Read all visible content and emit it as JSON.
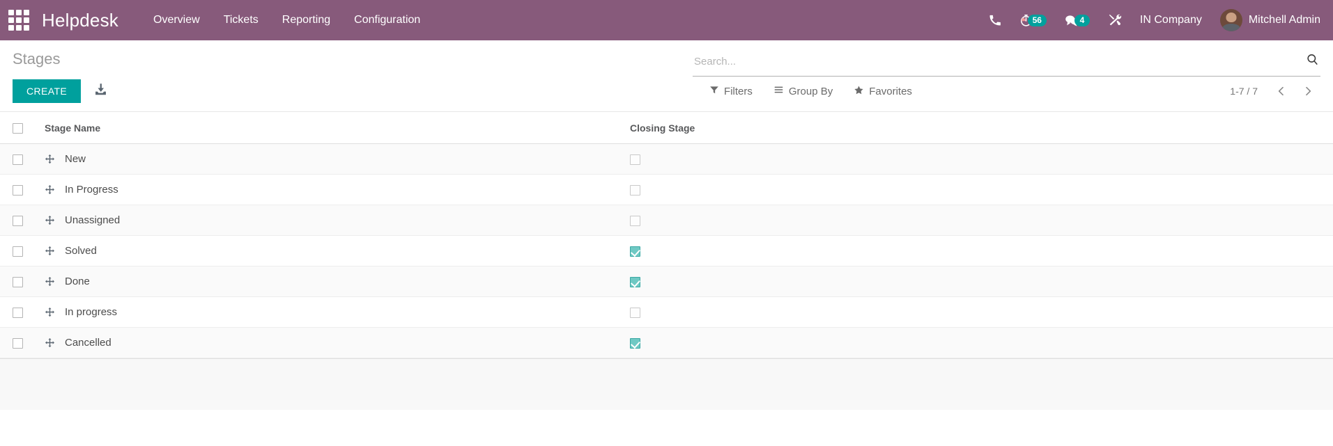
{
  "navbar": {
    "apps_icon": "apps-grid-icon",
    "brand": "Helpdesk",
    "menu_items": [
      {
        "label": "Overview"
      },
      {
        "label": "Tickets"
      },
      {
        "label": "Reporting"
      },
      {
        "label": "Configuration"
      }
    ],
    "icons": {
      "phone": "phone-icon",
      "timer": "timer-icon",
      "messages": "messages-icon",
      "tools": "tools-icon"
    },
    "timer_badge": "56",
    "messages_badge": "4",
    "company": "IN Company",
    "user": "Mitchell Admin",
    "background_color": "#875A7B",
    "badge_color": "#00A09D"
  },
  "control_panel": {
    "title": "Stages",
    "create_label": "CREATE",
    "import_icon": "import-download-icon",
    "create_color": "#00A09D"
  },
  "search": {
    "placeholder": "Search...",
    "value": "",
    "icon": "search-icon"
  },
  "filters": {
    "filters_label": "Filters",
    "filters_icon": "filter-funnel-icon",
    "group_by_label": "Group By",
    "group_by_icon": "group-by-bars-icon",
    "favorites_label": "Favorites",
    "favorites_icon": "star-icon"
  },
  "pager": {
    "value": "1-7 / 7",
    "previous_icon": "chevron-left-icon",
    "next_icon": "chevron-right-icon"
  },
  "list": {
    "columns": [
      {
        "key": "select",
        "label": ""
      },
      {
        "key": "name",
        "label": "Stage Name"
      },
      {
        "key": "closing",
        "label": "Closing Stage"
      }
    ],
    "rows": [
      {
        "name": "New",
        "closing": false,
        "drag_icon": "drag-handle-icon"
      },
      {
        "name": "In Progress",
        "closing": false,
        "drag_icon": "drag-handle-icon"
      },
      {
        "name": "Unassigned",
        "closing": false,
        "drag_icon": "drag-handle-icon"
      },
      {
        "name": "Solved",
        "closing": true,
        "drag_icon": "drag-handle-icon"
      },
      {
        "name": "Done",
        "closing": true,
        "drag_icon": "drag-handle-icon"
      },
      {
        "name": "In progress",
        "closing": false,
        "drag_icon": "drag-handle-icon"
      },
      {
        "name": "Cancelled",
        "closing": true,
        "drag_icon": "drag-handle-icon"
      }
    ],
    "checked_color": "#6fc9c4"
  }
}
